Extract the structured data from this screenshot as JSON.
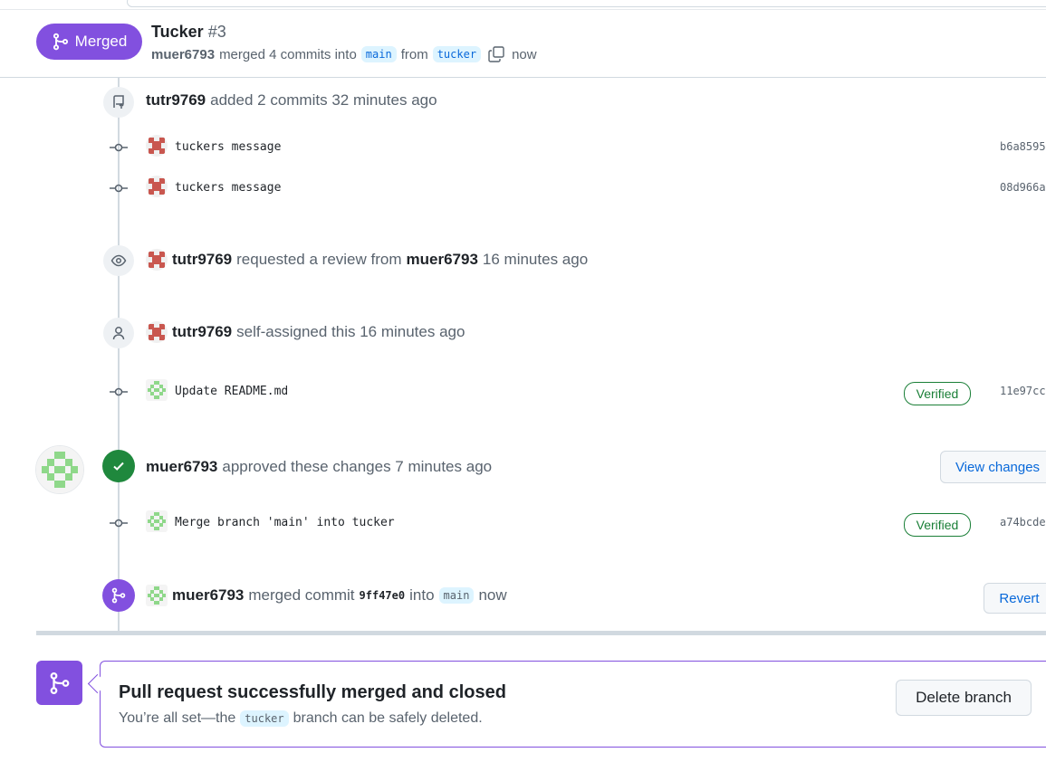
{
  "header": {
    "status_label": "Merged",
    "title": "Tucker",
    "number": "#3",
    "author": "muer6793",
    "merged_text": "merged 4 commits into",
    "base_branch": "main",
    "from_text": "from",
    "head_branch": "tucker",
    "time": "now"
  },
  "timeline": {
    "commits_added": {
      "user": "tutr9769",
      "text": "added 2 commits 32 minutes ago",
      "commits": [
        {
          "message": "tuckers message",
          "sha": "b6a8595"
        },
        {
          "message": "tuckers message",
          "sha": "08d966a"
        }
      ]
    },
    "review_requested": {
      "user": "tutr9769",
      "text": "requested a review from",
      "reviewer": "muer6793",
      "time": "16 minutes ago"
    },
    "self_assigned": {
      "user": "tutr9769",
      "text": "self-assigned this 16 minutes ago"
    },
    "commit_readme": {
      "message": "Update README.md",
      "verified": "Verified",
      "sha": "11e97cc"
    },
    "approval": {
      "user": "muer6793",
      "text": "approved these changes 7 minutes ago",
      "button": "View changes"
    },
    "commit_merge_main": {
      "message": "Merge branch 'main' into tucker",
      "verified": "Verified",
      "sha": "a74bcde"
    },
    "merged_event": {
      "user": "muer6793",
      "text": "merged commit",
      "commit": "9ff47e0",
      "into": "into",
      "branch": "main",
      "time": "now",
      "button": "Revert"
    }
  },
  "merge_box": {
    "title": "Pull request successfully merged and closed",
    "desc_before": "You’re all set—the",
    "branch": "tucker",
    "desc_after": "branch can be safely deleted.",
    "delete_button": "Delete branch"
  },
  "colors": {
    "merged_purple": "#8250df",
    "approve_green": "#1f883d",
    "link_blue": "#0969da"
  }
}
